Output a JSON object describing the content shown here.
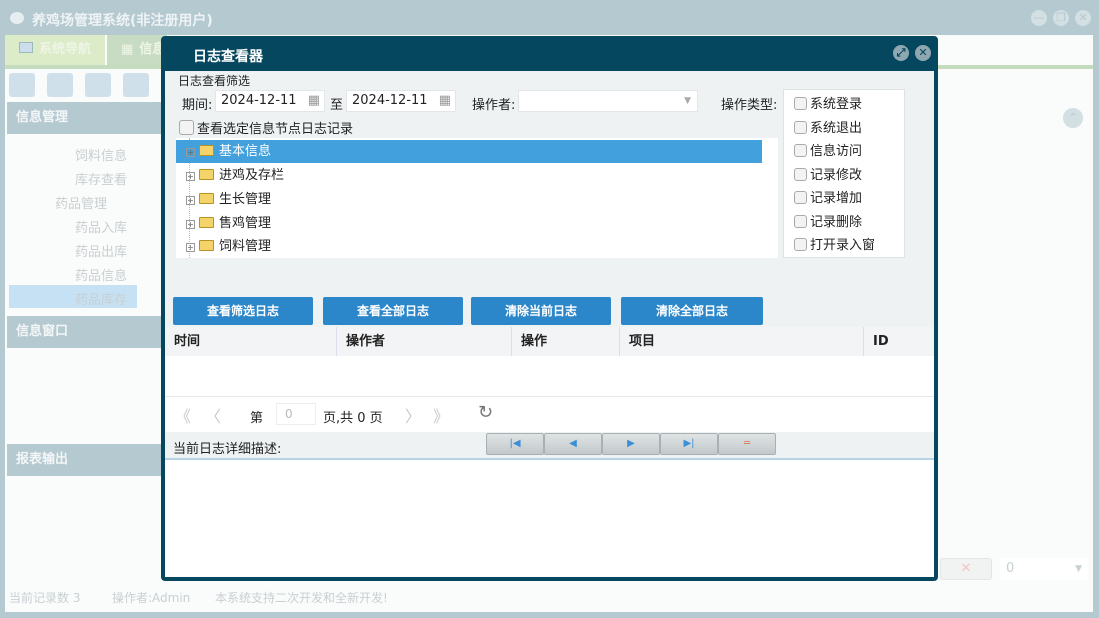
{
  "app": {
    "title": "养鸡场管理系统(非注册用户)"
  },
  "tabs": [
    {
      "label": "系统导航"
    },
    {
      "label": "信息"
    }
  ],
  "left": {
    "header": "信息管理",
    "tree": [
      "饲料信息",
      "库存查看",
      "药品管理",
      "药品入库",
      "药品出库",
      "药品信息",
      "药品库存"
    ],
    "panel2": "信息窗口",
    "panel3": "报表输出"
  },
  "status": {
    "records": "当前记录数 3",
    "operator": "操作者:Admin",
    "note": "本系统支持二次开发和全新开发!"
  },
  "bg_select": {
    "value": "0"
  },
  "dialog": {
    "title": "日志查看器",
    "filter_label": "日志查看筛选",
    "period_label": "期间:",
    "date_from": "2024-12-11",
    "to_label": "至",
    "date_to": "2024-12-11",
    "operator_label": "操作者:",
    "operator_value": "",
    "optype_label": "操作类型:",
    "optypes": [
      "系统登录",
      "系统退出",
      "信息访问",
      "记录修改",
      "记录增加",
      "记录删除",
      "打开录入窗"
    ],
    "node_check": "查看选定信息节点日志记录",
    "tree": [
      "基本信息",
      "进鸡及存栏",
      "生长管理",
      "售鸡管理",
      "饲料管理"
    ],
    "buttons": [
      "查看筛选日志",
      "查看全部日志",
      "清除当前日志",
      "清除全部日志"
    ],
    "columns": [
      "时间",
      "操作者",
      "操作",
      "项目",
      "ID"
    ],
    "pager": {
      "page_prefix": "第",
      "page": "0",
      "page_suffix": "页,共 0 页"
    },
    "detail_label": "当前日志详细描述:"
  },
  "colors": {
    "dialog_header": "#04475f",
    "button": "#2b87c9",
    "selected": "#42a0dc"
  }
}
